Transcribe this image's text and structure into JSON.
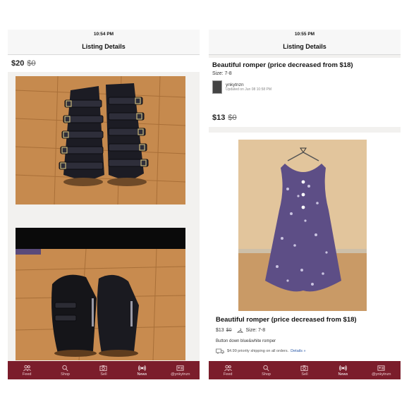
{
  "left": {
    "status_time": "10:54 PM",
    "nav_title": "Listing Details",
    "price": "$20",
    "original_price": "$0"
  },
  "right": {
    "status_time": "10:55 PM",
    "nav_title": "Listing Details",
    "listing_title": "Beautiful romper (price decreased from $18)",
    "size_text": "Size: 7-8",
    "seller": "ynkytnzn",
    "updated": "Updated on Jun 08 10:58 PM",
    "price": "$13",
    "original_price": "$0",
    "detail_title": "Beautiful romper (price decreased from $18)",
    "detail_price": "$13",
    "detail_original_price": "$0",
    "detail_size": "Size: 7-8",
    "description": "Button down blue&white romper",
    "shipping_text": "$4.99 priority shipping on all orders.",
    "shipping_link": "Details »"
  },
  "tabs": [
    {
      "label": "Feed",
      "icon": "people-icon"
    },
    {
      "label": "Shop",
      "icon": "search-icon"
    },
    {
      "label": "Sell",
      "icon": "camera-icon"
    },
    {
      "label": "News",
      "icon": "broadcast-icon"
    },
    {
      "label": "@ynkytnzn",
      "icon": "profile-card-icon"
    }
  ],
  "colors": {
    "tabbar": "#7b1d2b",
    "link": "#2b5aa8"
  }
}
